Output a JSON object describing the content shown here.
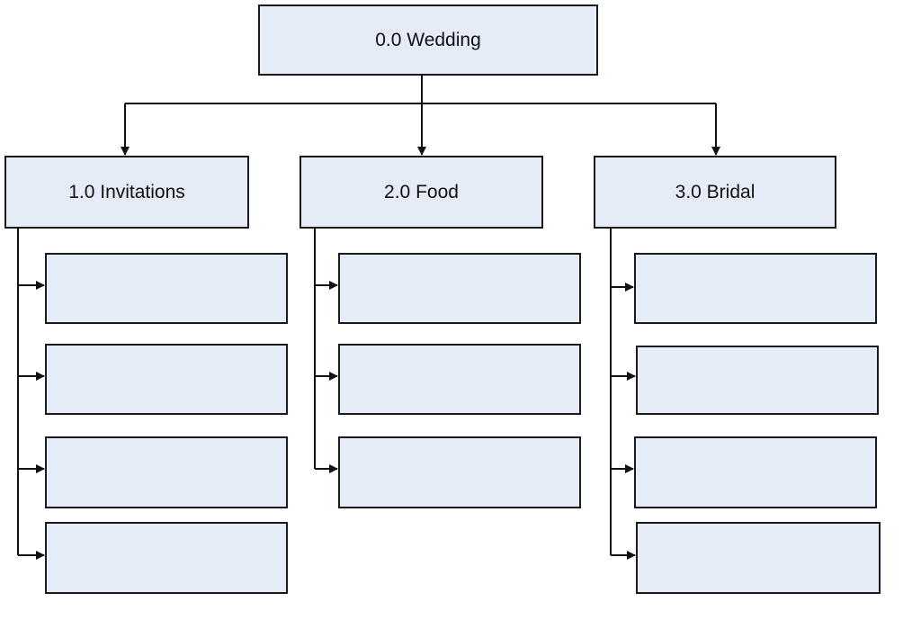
{
  "diagram": {
    "type": "work-breakdown-structure",
    "fill_color": "#e5ecf7",
    "stroke_color": "#1a1a1a",
    "root": {
      "id": "0.0",
      "label": "0.0 Wedding"
    },
    "branches": [
      {
        "id": "1.0",
        "label": "1.0 Invitations",
        "children": [
          "",
          "",
          "",
          ""
        ]
      },
      {
        "id": "2.0",
        "label": "2.0 Food",
        "children": [
          "",
          "",
          ""
        ]
      },
      {
        "id": "3.0",
        "label": "3.0 Bridal",
        "children": [
          "",
          "",
          "",
          ""
        ]
      }
    ]
  }
}
